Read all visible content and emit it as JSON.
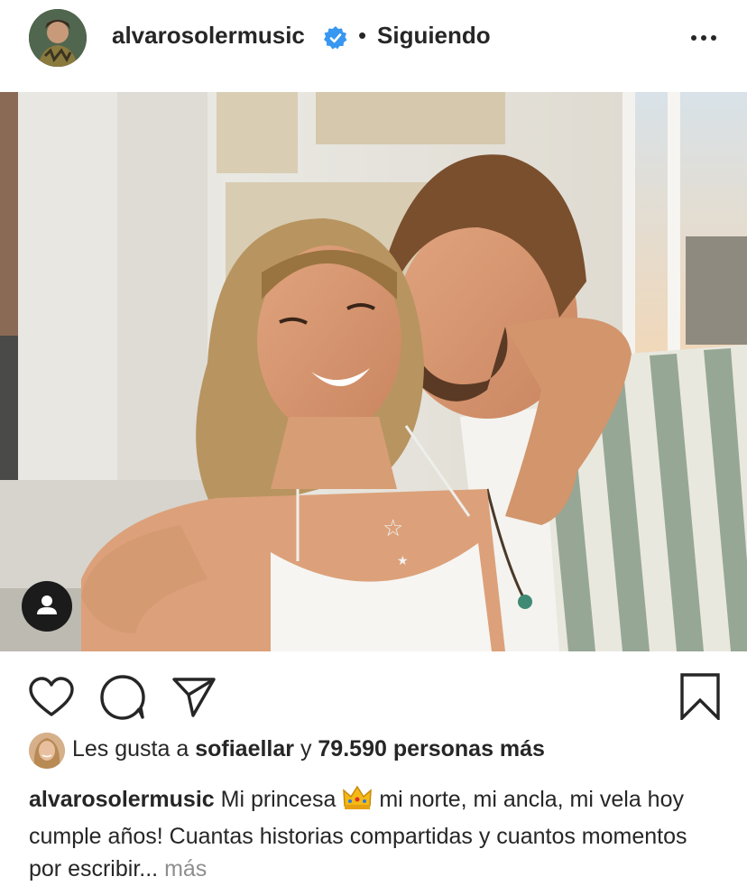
{
  "header": {
    "username": "alvarosolermusic",
    "separator": "•",
    "follow_status": "Siguiendo"
  },
  "icons": {
    "verified": "verified-badge-icon",
    "more": "more-options-icon",
    "tag": "user-tag-icon",
    "like": "heart-icon",
    "comment": "comment-icon",
    "share": "share-icon",
    "save": "bookmark-icon"
  },
  "colors": {
    "verified_blue": "#3897f0",
    "text": "#262626",
    "muted": "#8e8e8e"
  },
  "likes": {
    "prefix": "Les gusta a",
    "liker": "sofiaellar",
    "connector": "y",
    "count_text": "79.590 personas más"
  },
  "caption": {
    "username": "alvarosolermusic",
    "text_part1": "Mi princesa",
    "emoji": "👑",
    "text_part2": "mi norte, mi ancla, mi vela hoy cumple años! Cuantas historias compartidas y cuantos momentos por escribir...",
    "more_label": "más"
  }
}
